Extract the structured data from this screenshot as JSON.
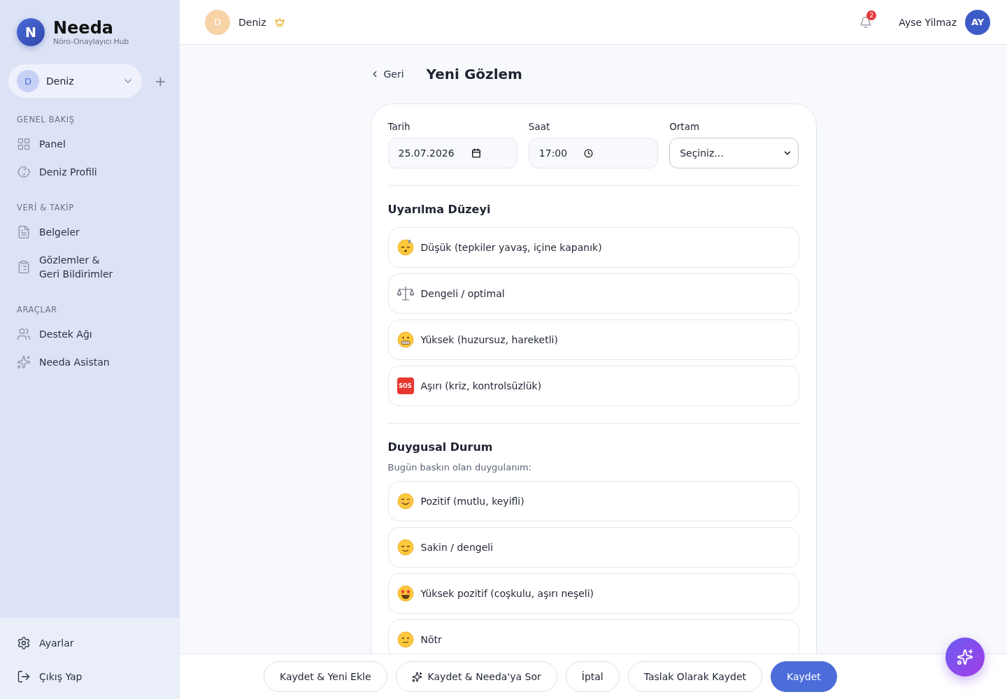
{
  "brand": {
    "logo_letter": "N",
    "name": "Needa",
    "tagline": "Nöro-Onaylayıcı Hub"
  },
  "child_switcher": {
    "avatar_letter": "D",
    "name": "Deniz",
    "add_label": "+"
  },
  "nav_sections": [
    {
      "title": "GENEL BAKIŞ",
      "items": [
        {
          "label": "Panel",
          "kind": "grid",
          "selected": false
        },
        {
          "label": "Deniz Profili",
          "kind": "baby",
          "selected": false
        }
      ]
    },
    {
      "title": "VERİ & TAKİP",
      "items": [
        {
          "label": "Belgeler",
          "kind": "file",
          "selected": false
        },
        {
          "label": "Gözlemler & Geri Bildirimler",
          "kind": "clipboard",
          "selected": false
        }
      ]
    },
    {
      "title": "ARAÇLAR",
      "items": [
        {
          "label": "Destek Ağı",
          "kind": "users",
          "selected": false
        },
        {
          "label": "Needa Asistan",
          "kind": "sparkles",
          "selected": false
        }
      ]
    }
  ],
  "sidebar_footer": [
    {
      "label": "Ayarlar",
      "kind": "gear"
    },
    {
      "label": "Çıkış Yap",
      "kind": "logout"
    }
  ],
  "topbar": {
    "child_avatar": "D",
    "child_name": "Deniz",
    "premium": true,
    "notification_count": "2",
    "user_name": "Ayse Yilmaz",
    "user_initials": "AY"
  },
  "page": {
    "back_label": "Geri",
    "title": "Yeni Gözlem"
  },
  "fields": [
    {
      "label": "Tarih",
      "kind": "date",
      "value": "25.07.2026"
    },
    {
      "label": "Saat",
      "kind": "time",
      "value": "17:00"
    },
    {
      "label": "Ortam",
      "kind": "select",
      "value": "Seçiniz..."
    }
  ],
  "sections": [
    {
      "title": "Uyarılma Düzeyi",
      "options": [
        {
          "kind": "sleepy",
          "label": "Düşük (tepkiler yavaş, içine kapanık)",
          "selected": false
        },
        {
          "kind": "scales",
          "label": "Dengeli / optimal",
          "selected": false
        },
        {
          "kind": "grimace",
          "label": "Yüksek (huzursuz, hareketli)",
          "selected": false
        },
        {
          "kind": "sos",
          "label": "Aşırı (kriz, kontrolsüzlük)",
          "badge": "SOS",
          "selected": false
        }
      ]
    },
    {
      "title": "Duygusal Durum",
      "subtitle": "Bugün baskın olan duygulanım:",
      "options": [
        {
          "kind": "smile",
          "label": "Pozitif (mutlu, keyifli)",
          "selected": false
        },
        {
          "kind": "calm",
          "label": "Sakin / dengeli",
          "selected": false
        },
        {
          "kind": "starstruck",
          "label": "Yüksek pozitif (coşkulu, aşırı neşeli)",
          "selected": false
        },
        {
          "kind": "neutral",
          "label": "Nötr",
          "selected": false
        }
      ]
    }
  ],
  "actions": [
    {
      "label": "Kaydet & Yeni Ekle",
      "kind": "secondary"
    },
    {
      "label": "Kaydet & Needa'ya Sor",
      "kind": "ai"
    },
    {
      "label": "İptal",
      "kind": "secondary"
    },
    {
      "label": "Taslak Olarak Kaydet",
      "kind": "secondary"
    },
    {
      "label": "Kaydet",
      "kind": "primary"
    }
  ]
}
